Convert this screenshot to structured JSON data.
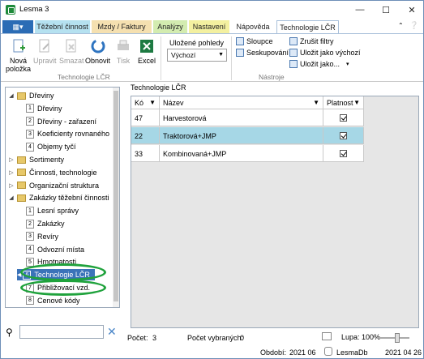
{
  "window": {
    "title": "Lesma 3"
  },
  "tabs": [
    "Těžební činnost",
    "Mzdy / Faktury",
    "Analýzy",
    "Nastavení",
    "Nápověda",
    "Technologie LČR"
  ],
  "ribbon": {
    "buttons": {
      "nova_polozka_l1": "Nová",
      "nova_polozka_l2": "položka",
      "upravit": "Upravit",
      "smazat": "Smazat",
      "obnovit": "Obnovit",
      "tisk": "Tisk",
      "excel": "Excel"
    },
    "group_label_main": "Technologie LČR",
    "saved_views_label": "Uložené pohledy",
    "saved_views_value": "Výchozí",
    "tools": {
      "sloupce": "Sloupce",
      "seskupovani": "Seskupování",
      "zrusit_filtry": "Zrušit filtry",
      "ulozit_vychozi": "Uložit jako výchozí",
      "ulozit_jako": "Uložit jako..."
    },
    "group_label_tools": "Nástroje"
  },
  "tree": [
    {
      "label": "Dřeviny",
      "type": "folder",
      "expanded": true
    },
    {
      "label": "Dřeviny",
      "num": "1"
    },
    {
      "label": "Dřeviny - zařazení",
      "num": "2"
    },
    {
      "label": "Koeficienty rovnaného",
      "num": "3"
    },
    {
      "label": "Objemy tyčí",
      "num": "4"
    },
    {
      "label": "Sortimenty",
      "type": "folder",
      "expanded": false
    },
    {
      "label": "Činnosti, technologie",
      "type": "folder",
      "expanded": false
    },
    {
      "label": "Organizační struktura",
      "type": "folder",
      "expanded": false
    },
    {
      "label": "Zakázky těžební činnosti",
      "type": "folder",
      "expanded": true
    },
    {
      "label": "Lesní správy",
      "num": "1"
    },
    {
      "label": "Zakázky",
      "num": "2"
    },
    {
      "label": "Revíry",
      "num": "3"
    },
    {
      "label": "Odvozní místa",
      "num": "4"
    },
    {
      "label": "Hmotnatosti",
      "num": "5"
    },
    {
      "label": "Technologie LČR",
      "num": "6",
      "selected": true
    },
    {
      "label": "Přibližovací vzd.",
      "num": "7"
    },
    {
      "label": "Cenové kódy",
      "num": "8"
    }
  ],
  "main": {
    "header": "Technologie LČR",
    "columns": [
      "Kó",
      "Název",
      "Platnost"
    ],
    "rows": [
      {
        "code": "47",
        "name": "Harvestorová",
        "valid": true
      },
      {
        "code": "22",
        "name": "Traktorová+JMP",
        "valid": true,
        "selected": true
      },
      {
        "code": "33",
        "name": "Kombinovaná+JMP",
        "valid": true
      }
    ]
  },
  "status": {
    "count_label": "Počet:",
    "count_value": "3",
    "selected_label": "Počet vybraných:",
    "selected_value": "0",
    "zoom_label": "Lupa: 100%",
    "period_label": "Období:",
    "period_value": "2021 06",
    "db_label": "LesmaDb",
    "date_value": "2021 04 26"
  },
  "colors": {
    "accent": "#3b73b9",
    "selected_row": "#a6d7e6",
    "highlight": "#1fa23c"
  }
}
